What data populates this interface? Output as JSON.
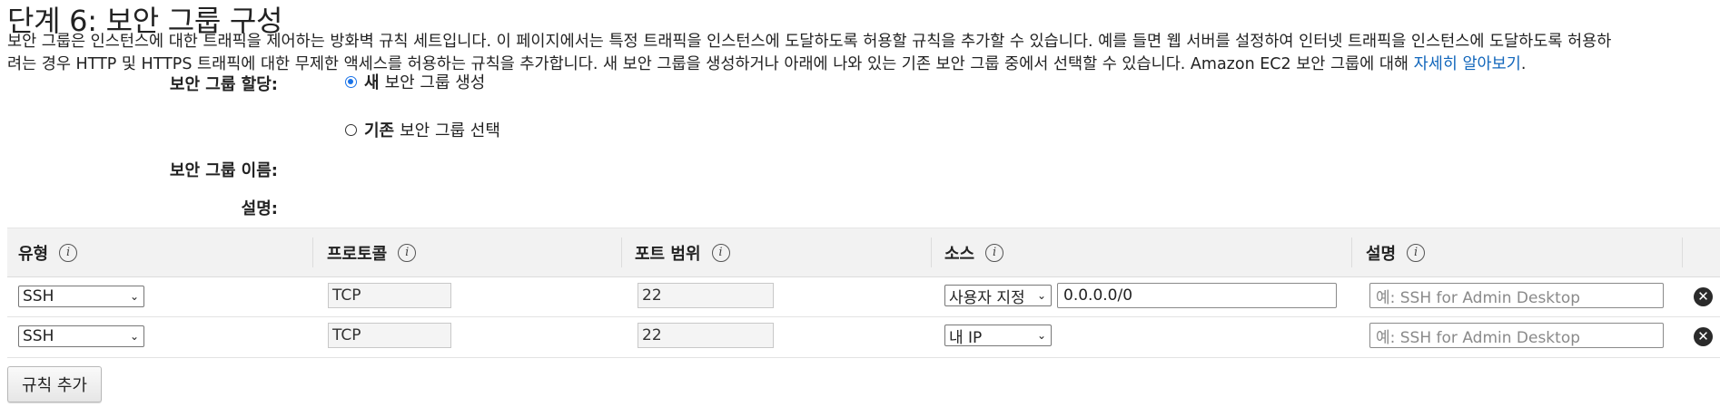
{
  "page": {
    "title": "단계 6: 보안 그룹 구성",
    "intro_line1": "보안 그룹은 인스턴스에 대한 트래픽을 제어하는 방화벽 규칙 세트입니다. 이 페이지에서는 특정 트래픽을 인스턴스에 도달하도록 허용할 규칙을 추가할 수 있습니다. 예를 들면 웹 서버를 설정하여 인터넷 트래픽을 인스턴스에 도달하도록 허용하",
    "intro_line2": "려는 경우 HTTP 및 HTTPS 트래픽에 대한 무제한 액세스를 허용하는 규칙을 추가합니다. 새 보안 그룹을 생성하거나 아래에 나와 있는 기존 보안 그룹 중에서 선택할 수 있습니다. Amazon EC2 보안 그룹에 대해 ",
    "learn_more_link": "자세히 알아보기",
    "intro_end": "."
  },
  "form": {
    "assign_label": "보안 그룹 할당:",
    "option_new_bold": "새",
    "option_new_rest": "보안 그룹 생성",
    "option_existing_bold": "기존",
    "option_existing_rest": "보안 그룹 선택",
    "selected_option": "new",
    "name_label": "보안 그룹 이름:",
    "name_value": "",
    "desc_label": "설명:",
    "desc_value": ""
  },
  "table": {
    "headers": {
      "type": "유형",
      "protocol": "프로토콜",
      "port_range": "포트 범위",
      "source": "소스",
      "description": "설명"
    },
    "rows": [
      {
        "type": "SSH",
        "protocol": "TCP",
        "port": "22",
        "source_mode": "사용자 지정",
        "source_value": "0.0.0.0/0",
        "description_placeholder": "예: SSH for Admin Desktop"
      },
      {
        "type": "SSH",
        "protocol": "TCP",
        "port": "22",
        "source_mode": "내 IP",
        "source_value": "",
        "description_placeholder": "예: SSH for Admin Desktop"
      }
    ]
  },
  "actions": {
    "add_rule": "규칙 추가"
  },
  "colors": {
    "link": "#1166bb",
    "radio_accent": "#1a73e8",
    "header_bg": "#f2f2f2"
  },
  "icons": {
    "info": "info-circle-icon",
    "remove": "remove-circle-icon",
    "dropdown": "chevron-down-icon"
  }
}
